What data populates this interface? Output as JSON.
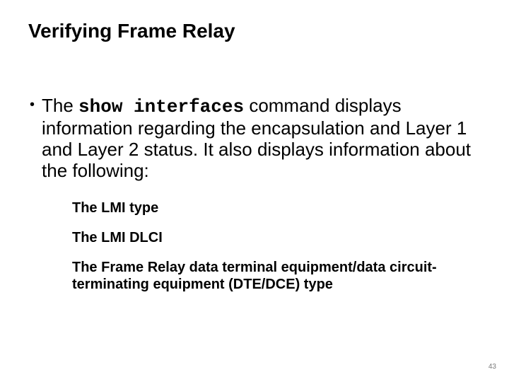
{
  "title": "Verifying Frame Relay",
  "bullet": {
    "prefix": "The ",
    "command": "show interfaces",
    "rest": " command displays information regarding the encapsulation and Layer 1 and Layer 2 status. It also displays information about the following:"
  },
  "subitems": [
    "The LMI type",
    "The LMI DLCI",
    "The Frame Relay data terminal equipment/data circuit-terminating equipment (DTE/DCE) type"
  ],
  "page_number": "43"
}
